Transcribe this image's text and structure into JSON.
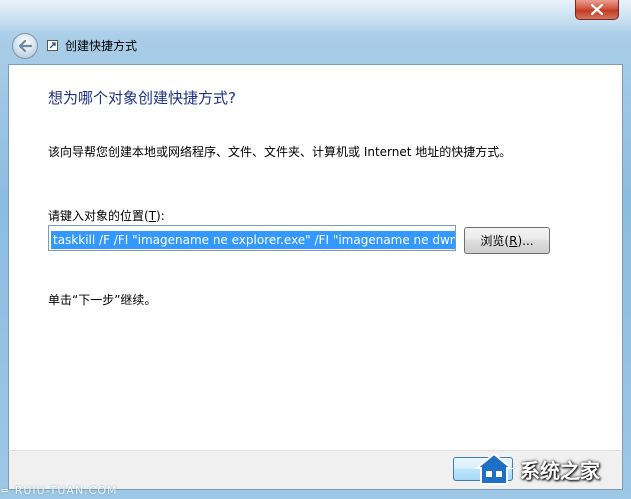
{
  "window": {
    "nav_title": "创建快捷方式",
    "close_icon": "close-icon",
    "back_icon": "back-arrow-icon",
    "shortcut_icon": "shortcut-icon"
  },
  "content": {
    "heading": "想为哪个对象创建快捷方式?",
    "description": "该向导帮您创建本地或网络程序、文件、文件夹、计算机或 Internet 地址的快捷方式。",
    "field_label_prefix": "请键入对象的位置(",
    "field_label_key": "T",
    "field_label_suffix": "):",
    "target_value": "taskkill /F /FI \"imagename ne explorer.exe\" /FI \"imagename ne dwm.exe\"",
    "browse_prefix": "浏览(",
    "browse_key": "R",
    "browse_suffix": ")...",
    "hint": "单击“下一步”继续。"
  },
  "watermark": {
    "logo_text": "系统之家",
    "site_text": "= RUIU-TUAN.COM"
  },
  "colors": {
    "heading": "#1e3287",
    "selection": "#3399ff",
    "close": "#c23b24",
    "frame": "#8cbcdf"
  }
}
